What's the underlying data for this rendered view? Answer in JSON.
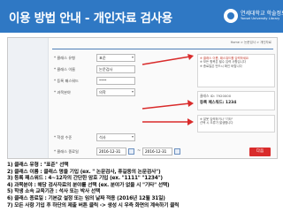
{
  "header": {
    "title": "이용 방법 안내 - 개인자료 검사용",
    "logo_ko": "연세대학교 학술정보원",
    "logo_en": "Yonsei University Library",
    "background": "#2f78c4"
  },
  "form": {
    "breadcrumb": "Home > 논문검사 > 개인자료",
    "fields": [
      {
        "label": "* 클래스 유형",
        "value": "표준"
      },
      {
        "label": "* 클래스 이름",
        "value": "논문검사"
      },
      {
        "label": "* 등록 패스워드",
        "value": "****"
      },
      {
        "label": "* 과목분야",
        "value": "의학"
      },
      {
        "label": "* 학생 수준",
        "value": "석사"
      }
    ],
    "date_label": "* 클래스 종료일",
    "date_start": "2016-12-31",
    "date_end": "2016-12-31",
    "note_lines": [
      "※ 클래스 이름, 패스워드를 입력하세요",
      "※ 모든 항목은 필수 입력 사항입니다",
      "※ 종료일은 반드시 확인 바랍니다"
    ],
    "info_label": "클래스 ID: 7920000",
    "info_value": "등록 패스워드: 1234",
    "mini_note_lines": [
      "※ 잘못 입력하거나 \"기타\"",
      "선택 시 오류가 발생합니다"
    ],
    "next_button": "다음"
  },
  "steps": [
    "1) 클래스 유형 : \"표준\" 선택",
    "2) 클래스 이름 : 클래스 명을 기입 (ex. \" 논문검사, 휴길동의 논문검사\")",
    "3) 등록 패스워드 :  4~12자의 간단한 암호 기입 (ex. \"1111\" \"1234\")",
    "4) 과목분야 : 해당 검사자료의 분야를 선택 (ex. 분야가 없을 시 \"기타\" 선택)",
    "5) 학생 소속 교육기관 : 석사 또는 박사 선택",
    "6) 클래스 종료일 : 기본값 설정 또는 임의 날짜 적용 (2016년 12월 31일)",
    "7) 모든 사항 기입 후 하단의 제출 버튼 클릭 -> 생성 시 우측 화면의 계속하기 클릭"
  ]
}
